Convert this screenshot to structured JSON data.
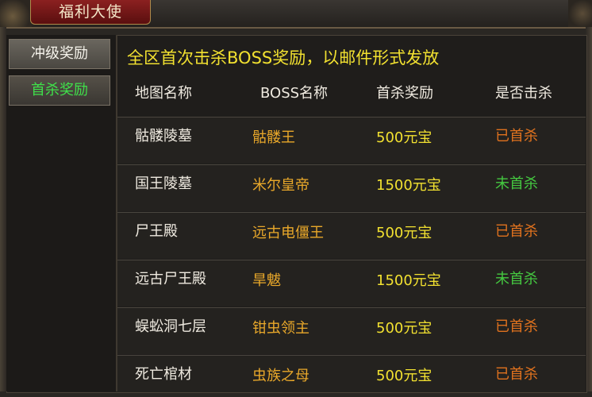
{
  "window": {
    "title": "福利大使"
  },
  "sidebar": {
    "items": [
      {
        "label": "冲级奖励",
        "active": false
      },
      {
        "label": "首杀奖励",
        "active": true
      }
    ]
  },
  "main": {
    "banner": "全区首次击杀BOSS奖励，以邮件形式发放",
    "columns": [
      "地图名称",
      "BOSS名称",
      "首杀奖励",
      "是否击杀"
    ],
    "rows": [
      {
        "map": "骷髅陵墓",
        "boss": "骷髅王",
        "reward": "500元宝",
        "status": "已首杀",
        "killed": true
      },
      {
        "map": "国王陵墓",
        "boss": "米尔皇帝",
        "reward": "1500元宝",
        "status": "未首杀",
        "killed": false
      },
      {
        "map": "尸王殿",
        "boss": "远古电僵王",
        "reward": "500元宝",
        "status": "已首杀",
        "killed": true
      },
      {
        "map": "远古尸王殿",
        "boss": "旱魃",
        "reward": "1500元宝",
        "status": "未首杀",
        "killed": false
      },
      {
        "map": "蜈蚣洞七层",
        "boss": "钳虫领主",
        "reward": "500元宝",
        "status": "已首杀",
        "killed": true
      },
      {
        "map": "死亡棺材",
        "boss": "虫族之母",
        "reward": "500元宝",
        "status": "已首杀",
        "killed": true
      }
    ]
  },
  "colors": {
    "banner": "#f2e130",
    "boss_name": "#e9a82a",
    "reward": "#f2e130",
    "killed": "#e0721e",
    "not_killed": "#45c840",
    "active_tab": "#3fe04a"
  }
}
